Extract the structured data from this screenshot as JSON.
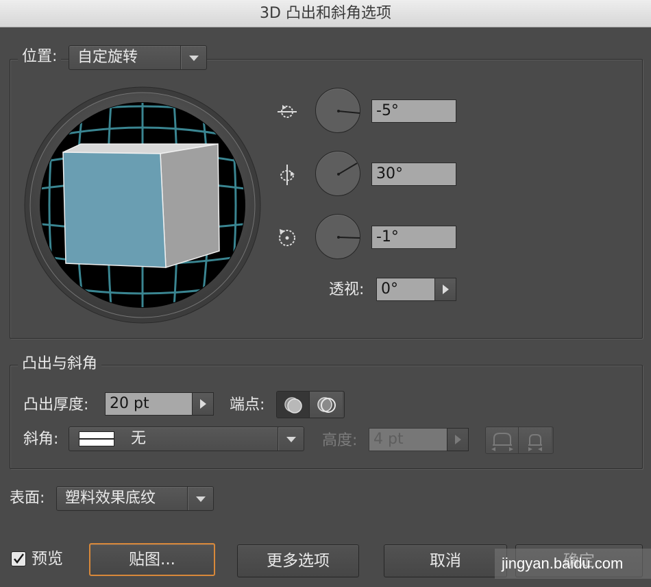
{
  "window": {
    "title": "3D 凸出和斜角选项"
  },
  "position_group": {
    "label": "位置:",
    "preset_value": "自定旋转",
    "x_angle": "-5°",
    "y_angle": "30°",
    "z_angle": "-1°",
    "perspective_label": "透视:",
    "perspective_value": "0°"
  },
  "extrude_group": {
    "title": "凸出与斜角",
    "depth_label": "凸出厚度:",
    "depth_value": "20 pt",
    "cap_label": "端点:",
    "bevel_label": "斜角:",
    "bevel_value": "无",
    "height_label": "高度:",
    "height_value": "4 pt"
  },
  "surface": {
    "label": "表面:",
    "value": "塑料效果底纹"
  },
  "footer": {
    "preview_label": "预览",
    "preview_checked": true,
    "map_button": "贴图...",
    "more_options_button": "更多选项",
    "cancel_button": "取消",
    "ok_button": "确定",
    "watermark": "jingyan.baidu.com"
  },
  "colors": {
    "cube_front": "#6a9eb2",
    "cube_side": "#a0a0a0",
    "cube_top": "#d8d8d8",
    "sphere_grid": "#3a8591",
    "focus_ring": "#d9893a"
  }
}
